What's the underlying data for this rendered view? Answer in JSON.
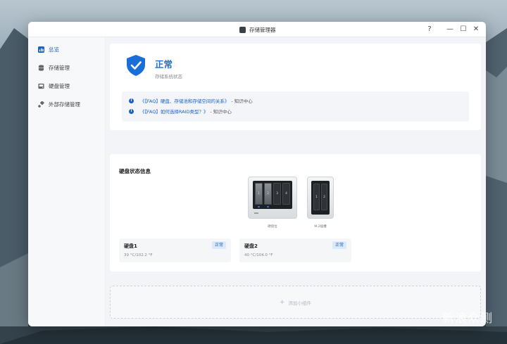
{
  "window": {
    "title": "存储管理器",
    "controls": {
      "help": "?",
      "minimize": "—",
      "maximize": "☐",
      "close": "✕"
    }
  },
  "sidebar": {
    "items": [
      {
        "label": "总览",
        "icon": "overview-icon",
        "active": true
      },
      {
        "label": "存储管理",
        "icon": "database-icon",
        "active": false
      },
      {
        "label": "硬盘管理",
        "icon": "hard-drive-icon",
        "active": false
      },
      {
        "label": "外部存储管理",
        "icon": "usb-icon",
        "active": false
      }
    ]
  },
  "status": {
    "title": "正常",
    "subtitle": "存储系统状态",
    "faq": [
      {
        "link": "《【FAQ】硬盘、存储池和存储空间的关系》",
        "suffix": "- 知识中心"
      },
      {
        "link": "《【FAQ】如何选择RAID类型？》",
        "suffix": "- 知识中心"
      }
    ]
  },
  "disk_info": {
    "title": "硬盘状态信息",
    "devices": [
      {
        "caption": "硬盘位",
        "bays": [
          "1",
          "2",
          "3",
          "4"
        ]
      },
      {
        "caption": "M.2插槽",
        "bays": [
          "1",
          "2"
        ]
      }
    ],
    "disks": [
      {
        "name": "硬盘1",
        "temp": "39 °C/102.2 °F",
        "status": "正常"
      },
      {
        "name": "硬盘2",
        "temp": "40 °C/104.0 °F",
        "status": "正常"
      }
    ]
  },
  "add_widget": {
    "icon": "+",
    "label": "添加小组件"
  },
  "watermark": "新浪众测",
  "colors": {
    "accent": "#1a62c9",
    "status_ok": "#1a6ed8",
    "badge_bg": "#dde9fb"
  }
}
